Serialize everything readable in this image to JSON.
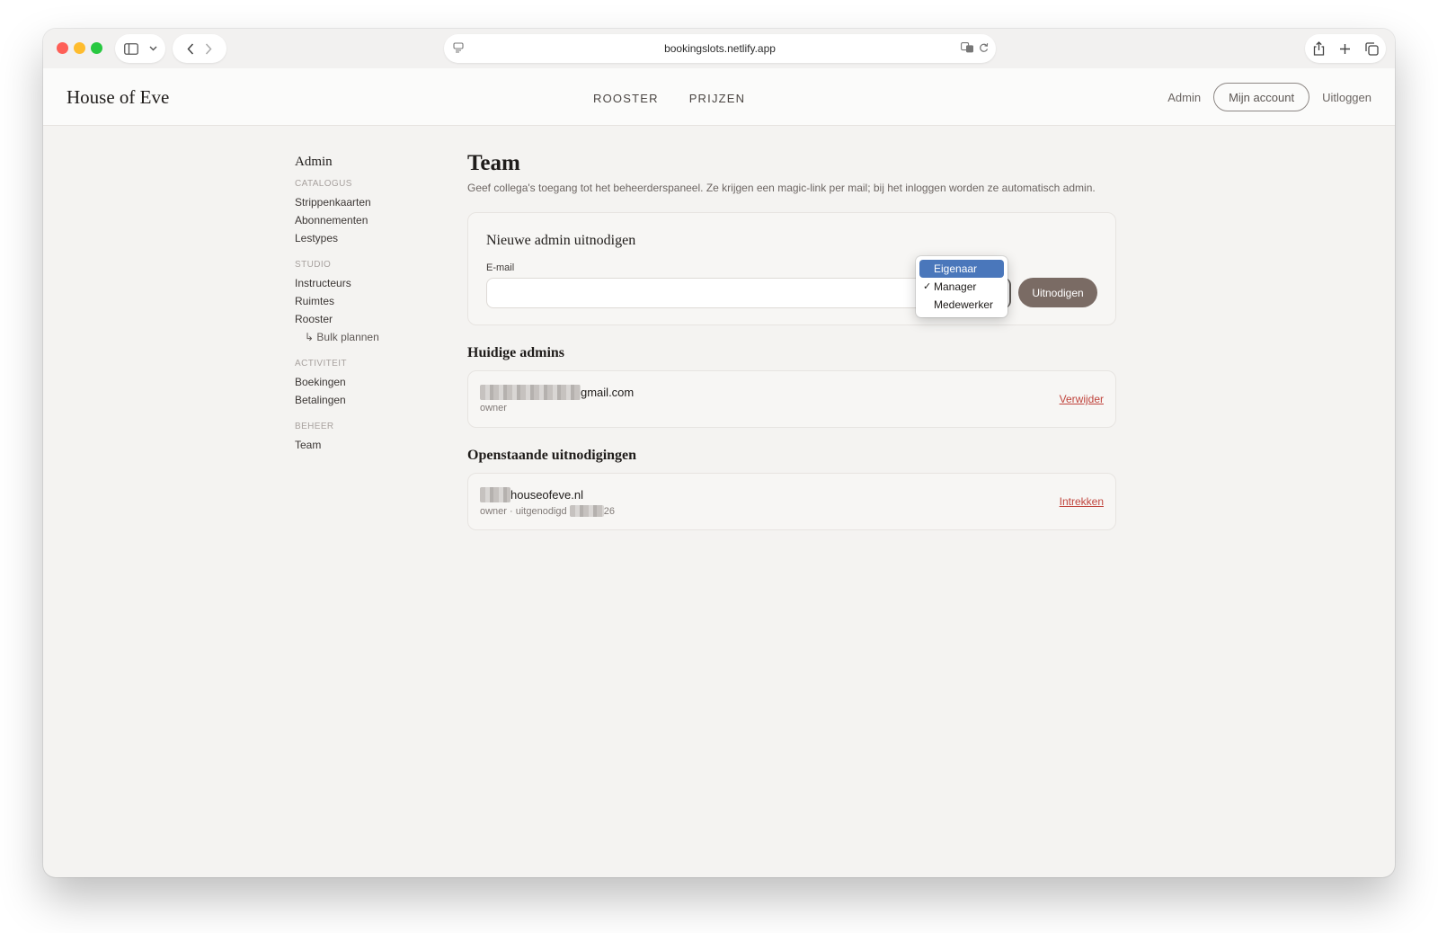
{
  "browser": {
    "url": "bookingslots.netlify.app",
    "icons": [
      "sidebar-icon",
      "chevron-down-icon",
      "back-icon",
      "forward-icon",
      "site-settings-icon",
      "translate-icon",
      "reload-icon",
      "share-icon",
      "new-tab-icon",
      "tabs-overview-icon"
    ]
  },
  "header": {
    "brand": "House of Eve",
    "nav": [
      "ROOSTER",
      "PRIJZEN"
    ],
    "admin_link": "Admin",
    "account_button": "Mijn account",
    "logout_link": "Uitloggen"
  },
  "sidebar": {
    "title": "Admin",
    "sections": [
      {
        "label": "CATALOGUS",
        "items": [
          "Strippenkaarten",
          "Abonnementen",
          "Lestypes"
        ]
      },
      {
        "label": "STUDIO",
        "items": [
          "Instructeurs",
          "Ruimtes",
          "Rooster"
        ],
        "sub_item": "↳ Bulk plannen"
      },
      {
        "label": "ACTIVITEIT",
        "items": [
          "Boekingen",
          "Betalingen"
        ]
      },
      {
        "label": "BEHEER",
        "items": [
          "Team"
        ]
      }
    ]
  },
  "main": {
    "title": "Team",
    "description": "Geef collega's toegang tot het beheerderspaneel. Ze krijgen een magic-link per mail; bij het inloggen worden ze automatisch admin.",
    "invite": {
      "title": "Nieuwe admin uitnodigen",
      "email_label": "E-mail",
      "email_value": "",
      "role_options": [
        "Eigenaar",
        "Manager",
        "Medewerker"
      ],
      "highlighted_option": "Eigenaar",
      "selected_option": "Manager",
      "check_mark": "✓",
      "submit_label": "Uitnodigen"
    },
    "current_admins": {
      "title": "Huidige admins",
      "rows": [
        {
          "email_visible": "gmail.com",
          "role": "owner",
          "action": "Verwijder"
        }
      ]
    },
    "pending": {
      "title": "Openstaande uitnodigingen",
      "rows": [
        {
          "email_visible": "houseofeve.nl",
          "role": "owner",
          "invited_prefix": "· uitgenodigd",
          "date_visible": "26",
          "action": "Intrekken"
        }
      ]
    }
  },
  "colors": {
    "accent_button": "#7a6b64",
    "danger_link": "#c0453d",
    "dropdown_highlight": "#4a77bb",
    "page_bg": "#f4f3f1"
  }
}
